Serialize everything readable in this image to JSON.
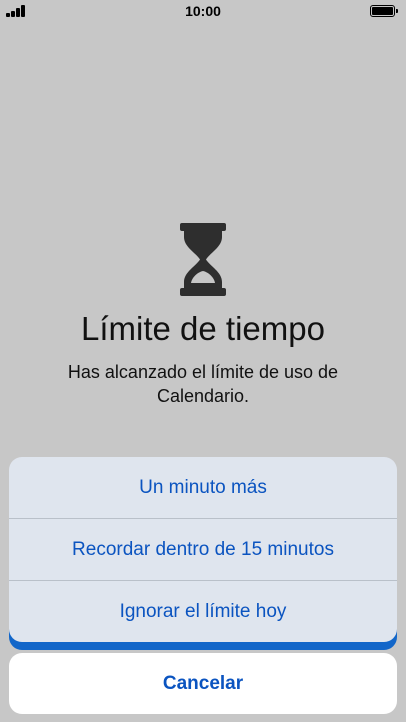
{
  "status_bar": {
    "time": "10:00",
    "signal_icon": "signal-bars-icon",
    "battery_icon": "battery-full-icon"
  },
  "screen_time": {
    "icon": "hourglass-icon",
    "title": "Límite de tiempo",
    "message": "Has alcanzado el límite de uso de Calendario."
  },
  "action_sheet": {
    "actions": [
      {
        "label": "Un minuto más"
      },
      {
        "label": "Recordar dentro de 15 minutos"
      },
      {
        "label": "Ignorar el límite hoy"
      }
    ],
    "cancel_label": "Cancelar"
  },
  "colors": {
    "background": "#c7c7c7",
    "sheet": "#dfe5ee",
    "action_text": "#0b54c0",
    "accent_blue": "#1266c9",
    "cancel_background": "#ffffff"
  }
}
